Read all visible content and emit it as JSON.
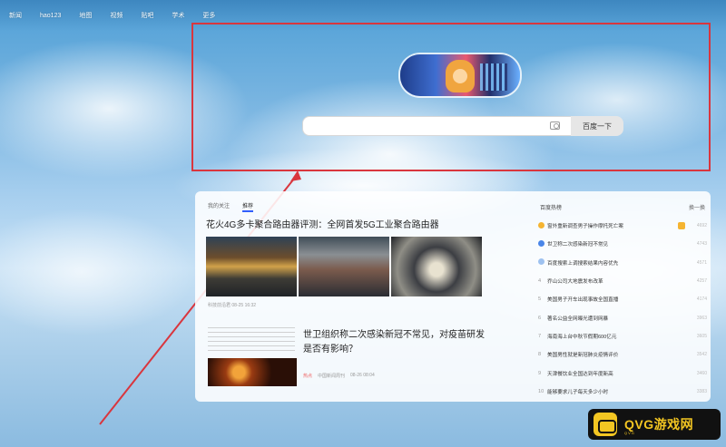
{
  "topbar": {
    "links": [
      "新闻",
      "hao123",
      "地图",
      "视频",
      "贴吧",
      "学术",
      "更多"
    ],
    "right_link": ""
  },
  "search": {
    "placeholder": "",
    "button_label": "百度一下"
  },
  "feed": {
    "tabs": [
      "我的关注",
      "推荐"
    ],
    "article1": {
      "title": "花火4G多卡聚合路由器评测：全网首发5G工业聚合路由器",
      "meta": "科技前沿君  08-25 16:32"
    },
    "article2": {
      "title": "世卫组织称二次感染新冠不常见，对疫苗研发是否有影响？",
      "tag": "热点",
      "source": "中国新闻周刊",
      "time": "08-26 08:04"
    }
  },
  "hotlist": {
    "title": "百度热榜",
    "refresh_label": "换一换",
    "items": [
      {
        "rank": "",
        "dot_color": "#f5b431",
        "text": "窗外重新调查男子操作摩托死亡案",
        "badge": true,
        "count": "4692"
      },
      {
        "rank": "",
        "dot_color": "#4a86e8",
        "text": "世卫称二次感染新冠不常见",
        "badge": false,
        "count": "4743"
      },
      {
        "rank": "",
        "dot_color": "#9ec2f0",
        "text": "百度搜索上调搜索结果内容优先",
        "badge": false,
        "count": "4571"
      },
      {
        "rank": "4",
        "dot_color": "",
        "text": "乔山公司大地震发布改革",
        "badge": false,
        "count": "4257"
      },
      {
        "rank": "5",
        "dot_color": "",
        "text": "美国男子开车出现事故全国直播",
        "badge": false,
        "count": "4174"
      },
      {
        "rank": "6",
        "dot_color": "",
        "text": "著名公益全网曝光遭到网暴",
        "badge": false,
        "count": "3963"
      },
      {
        "rank": "7",
        "dot_color": "",
        "text": "海南海上台中秋节假期600亿元",
        "badge": false,
        "count": "3605"
      },
      {
        "rank": "8",
        "dot_color": "",
        "text": "美国男性就是新冠肺炎疫情评价",
        "badge": false,
        "count": "3542"
      },
      {
        "rank": "9",
        "dot_color": "",
        "text": "天津餐饮业全国达到年度新高",
        "badge": false,
        "count": "3460"
      },
      {
        "rank": "10",
        "dot_color": "",
        "text": "能够要求儿子每天多少小时",
        "badge": false,
        "count": "3383"
      }
    ]
  },
  "watermark": {
    "text": "QVG游戏网",
    "sub": "QVG"
  },
  "colors": {
    "highlight": "#d9363e",
    "accent": "#315efb"
  }
}
